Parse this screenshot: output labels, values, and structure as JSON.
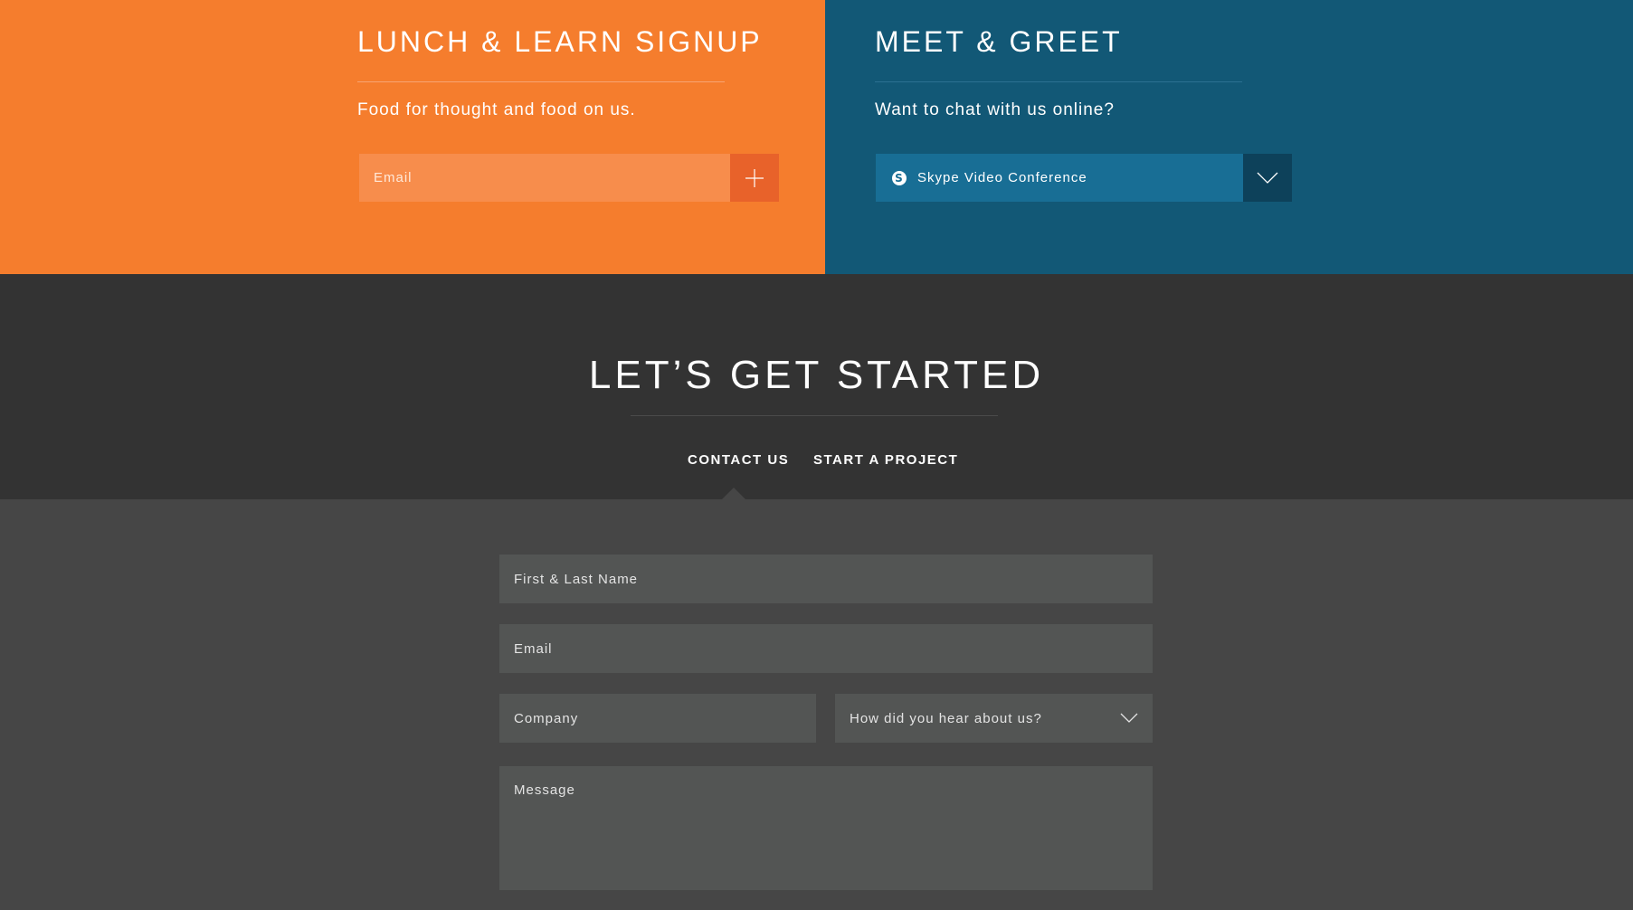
{
  "lunch": {
    "title": "LUNCH & LEARN SIGNUP",
    "subtitle": "Food for thought and food on us.",
    "email_placeholder": "Email",
    "add_icon": "plus-icon",
    "color": "#f57d2d"
  },
  "meet": {
    "title": "MEET & GREET",
    "subtitle": "Want to chat with us online?",
    "selected_option": "Skype Video Conference",
    "option_icon": "skype-icon",
    "toggle_icon": "chevron-down-icon",
    "color": "#125876"
  },
  "started": {
    "title": "LET’S GET STARTED",
    "tabs": [
      {
        "label": "CONTACT US",
        "active": true
      },
      {
        "label": "START A PROJECT",
        "active": false
      }
    ]
  },
  "form": {
    "name_placeholder": "First & Last Name",
    "email_placeholder": "Email",
    "company_placeholder": "Company",
    "referral_label": "How did you hear about us?",
    "message_placeholder": "Message"
  }
}
